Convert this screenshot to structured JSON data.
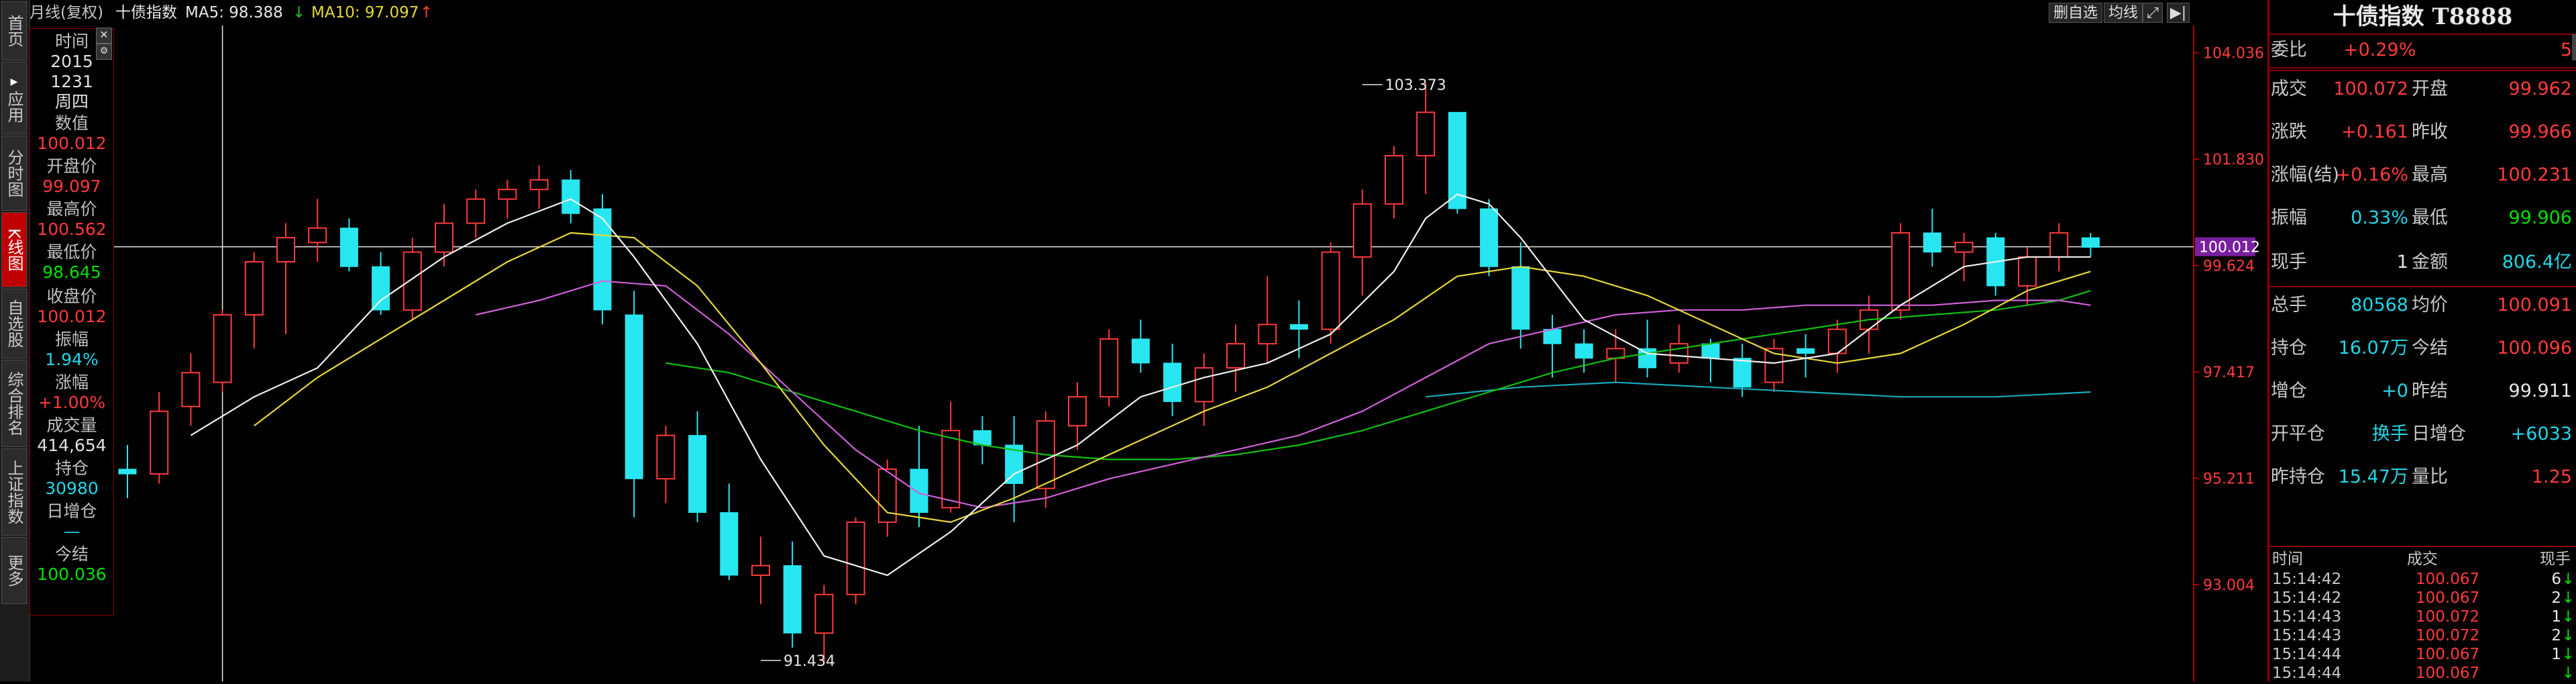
{
  "left_nav": [
    {
      "label": "首页",
      "active": false
    },
    {
      "label": "应用",
      "active": false
    },
    {
      "label": "分时图",
      "active": false
    },
    {
      "label": "K线图",
      "active": true
    },
    {
      "label": "自选股",
      "active": false
    },
    {
      "label": "综合排名",
      "active": false
    },
    {
      "label": "上证指数",
      "active": false
    },
    {
      "label": "更多",
      "active": false
    }
  ],
  "info_panel": {
    "time_label": "时间",
    "year": "2015",
    "date": "1231",
    "weekday": "周四",
    "value_label": "数值",
    "value": "100.012",
    "open_label": "开盘价",
    "open": "99.097",
    "high_label": "最高价",
    "high": "100.562",
    "low_label": "最低价",
    "low": "98.645",
    "close_label": "收盘价",
    "close": "100.012",
    "amplitude_label": "振幅",
    "amplitude": "1.94%",
    "change_label": "涨幅",
    "change": "+1.00%",
    "volume_label": "成交量",
    "volume": "414,654",
    "oi_label": "持仓",
    "oi": "30980",
    "daily_oi_label": "日增仓",
    "daily_oi": "—",
    "settle_label": "今结",
    "settle": "100.036"
  },
  "top_bar": {
    "period": "月线(复权)",
    "name": "十债指数",
    "ma5_label": "MA5: 98.388",
    "ma5_arrow": "↓",
    "ma10_label": "MA10: 97.097",
    "ma10_arrow": "↑",
    "btn_delete": "删自选",
    "btn_ma": "均线"
  },
  "colors": {
    "up": "#ff3b3b",
    "down": "#28e6f0",
    "ma5": "#f0f0f0",
    "ma10": "#e6d83a",
    "ma20": "#d060d8",
    "ma60": "#10c010",
    "ma120": "#1aa8b8",
    "accent": "#8a0000"
  },
  "chart_data": {
    "type": "candlestick",
    "period": "monthly",
    "y_ticks": [
      104.036,
      101.83,
      99.624,
      97.417,
      95.211,
      93.004
    ],
    "ylim": [
      91.0,
      104.6
    ],
    "current_price": 100.012,
    "max_annotation": 103.373,
    "min_annotation": 91.434,
    "max_index": 39,
    "min_index": 20,
    "crosshair_index": 3,
    "candles": [
      [
        95.4,
        95.9,
        94.8,
        95.3
      ],
      [
        95.3,
        97.0,
        95.1,
        96.6
      ],
      [
        96.7,
        97.8,
        96.3,
        97.4
      ],
      [
        97.2,
        98.7,
        97.0,
        98.6
      ],
      [
        98.6,
        99.9,
        97.9,
        99.7
      ],
      [
        99.7,
        100.5,
        98.2,
        100.2
      ],
      [
        100.1,
        101.0,
        99.7,
        100.4
      ],
      [
        100.4,
        100.6,
        99.5,
        99.6
      ],
      [
        99.6,
        99.9,
        98.6,
        98.7
      ],
      [
        98.7,
        100.2,
        98.5,
        99.9
      ],
      [
        99.9,
        100.9,
        99.6,
        100.5
      ],
      [
        100.5,
        101.2,
        100.2,
        101.0
      ],
      [
        101.0,
        101.4,
        100.6,
        101.2
      ],
      [
        101.2,
        101.7,
        100.8,
        101.4
      ],
      [
        101.4,
        101.6,
        100.5,
        100.7
      ],
      [
        100.8,
        101.1,
        98.4,
        98.7
      ],
      [
        98.6,
        99.1,
        94.4,
        95.2
      ],
      [
        95.2,
        96.3,
        94.7,
        96.1
      ],
      [
        96.1,
        96.6,
        94.3,
        94.5
      ],
      [
        94.5,
        95.1,
        93.1,
        93.2
      ],
      [
        93.2,
        94.0,
        92.6,
        93.4
      ],
      [
        93.4,
        93.9,
        91.7,
        92.0
      ],
      [
        92.0,
        93.0,
        91.4,
        92.8
      ],
      [
        92.8,
        94.4,
        92.6,
        94.3
      ],
      [
        94.3,
        95.6,
        94.0,
        95.4
      ],
      [
        95.4,
        96.3,
        94.2,
        94.5
      ],
      [
        94.6,
        96.8,
        94.5,
        96.2
      ],
      [
        96.2,
        96.5,
        95.5,
        95.9
      ],
      [
        95.9,
        96.5,
        94.3,
        95.1
      ],
      [
        95.0,
        96.6,
        94.6,
        96.4
      ],
      [
        96.3,
        97.2,
        95.8,
        96.9
      ],
      [
        96.9,
        98.3,
        96.7,
        98.1
      ],
      [
        98.1,
        98.5,
        97.4,
        97.6
      ],
      [
        97.6,
        98.0,
        96.5,
        96.8
      ],
      [
        96.8,
        97.8,
        96.3,
        97.5
      ],
      [
        97.5,
        98.4,
        97.0,
        98.0
      ],
      [
        98.0,
        99.4,
        97.6,
        98.4
      ],
      [
        98.4,
        98.9,
        97.7,
        98.3
      ],
      [
        98.3,
        100.1,
        98.0,
        99.9
      ],
      [
        99.8,
        101.2,
        99.0,
        100.9
      ],
      [
        100.9,
        102.1,
        100.6,
        101.9
      ],
      [
        101.9,
        103.4,
        101.1,
        102.8
      ],
      [
        102.8,
        102.8,
        100.7,
        100.8
      ],
      [
        100.8,
        101.0,
        99.4,
        99.6
      ],
      [
        99.6,
        100.1,
        97.9,
        98.3
      ],
      [
        98.3,
        98.6,
        97.3,
        98.0
      ],
      [
        98.0,
        98.3,
        97.4,
        97.7
      ],
      [
        97.7,
        98.3,
        97.2,
        97.9
      ],
      [
        97.9,
        98.5,
        97.3,
        97.5
      ],
      [
        97.6,
        98.4,
        97.4,
        98.0
      ],
      [
        98.0,
        98.1,
        97.2,
        97.7
      ],
      [
        97.7,
        98.0,
        96.9,
        97.1
      ],
      [
        97.2,
        98.1,
        97.0,
        97.9
      ],
      [
        97.9,
        98.2,
        97.3,
        97.8
      ],
      [
        97.8,
        98.5,
        97.4,
        98.3
      ],
      [
        98.3,
        99.0,
        97.8,
        98.7
      ],
      [
        98.7,
        100.5,
        98.5,
        100.3
      ],
      [
        100.3,
        100.8,
        99.6,
        99.9
      ],
      [
        99.9,
        100.3,
        99.3,
        100.1
      ],
      [
        100.2,
        100.3,
        99.0,
        99.2
      ],
      [
        99.2,
        100.0,
        98.8,
        99.8
      ],
      [
        99.8,
        100.5,
        99.5,
        100.3
      ],
      [
        100.2,
        100.3,
        99.8,
        100.0
      ]
    ],
    "ma5": [
      [
        2,
        96.1
      ],
      [
        4,
        96.9
      ],
      [
        6,
        97.5
      ],
      [
        8,
        98.9
      ],
      [
        10,
        99.8
      ],
      [
        12,
        100.5
      ],
      [
        14,
        101.0
      ],
      [
        15,
        100.6
      ],
      [
        16,
        99.8
      ],
      [
        18,
        98.0
      ],
      [
        20,
        95.6
      ],
      [
        22,
        93.6
      ],
      [
        24,
        93.2
      ],
      [
        26,
        94.1
      ],
      [
        28,
        95.3
      ],
      [
        30,
        95.9
      ],
      [
        32,
        96.9
      ],
      [
        34,
        97.3
      ],
      [
        36,
        97.6
      ],
      [
        38,
        98.2
      ],
      [
        40,
        99.5
      ],
      [
        41,
        100.6
      ],
      [
        42,
        101.1
      ],
      [
        43,
        100.9
      ],
      [
        44,
        100.2
      ],
      [
        46,
        98.5
      ],
      [
        48,
        97.8
      ],
      [
        50,
        97.7
      ],
      [
        52,
        97.6
      ],
      [
        54,
        97.8
      ],
      [
        56,
        98.8
      ],
      [
        58,
        99.6
      ],
      [
        60,
        99.8
      ],
      [
        62,
        99.8
      ]
    ],
    "ma10": [
      [
        4,
        96.3
      ],
      [
        6,
        97.3
      ],
      [
        8,
        98.1
      ],
      [
        10,
        98.9
      ],
      [
        12,
        99.7
      ],
      [
        14,
        100.3
      ],
      [
        16,
        100.2
      ],
      [
        18,
        99.2
      ],
      [
        20,
        97.6
      ],
      [
        22,
        95.9
      ],
      [
        24,
        94.5
      ],
      [
        26,
        94.3
      ],
      [
        28,
        94.8
      ],
      [
        30,
        95.4
      ],
      [
        32,
        96.0
      ],
      [
        34,
        96.6
      ],
      [
        36,
        97.1
      ],
      [
        38,
        97.8
      ],
      [
        40,
        98.5
      ],
      [
        42,
        99.4
      ],
      [
        44,
        99.6
      ],
      [
        46,
        99.4
      ],
      [
        48,
        99.0
      ],
      [
        50,
        98.4
      ],
      [
        52,
        97.8
      ],
      [
        54,
        97.6
      ],
      [
        56,
        97.8
      ],
      [
        58,
        98.4
      ],
      [
        60,
        99.1
      ],
      [
        62,
        99.5
      ]
    ],
    "ma20": [
      [
        11,
        98.6
      ],
      [
        13,
        98.9
      ],
      [
        15,
        99.3
      ],
      [
        17,
        99.2
      ],
      [
        19,
        98.2
      ],
      [
        21,
        97.0
      ],
      [
        23,
        95.8
      ],
      [
        25,
        94.9
      ],
      [
        27,
        94.6
      ],
      [
        29,
        94.8
      ],
      [
        31,
        95.2
      ],
      [
        33,
        95.5
      ],
      [
        35,
        95.8
      ],
      [
        37,
        96.1
      ],
      [
        39,
        96.6
      ],
      [
        41,
        97.3
      ],
      [
        43,
        98.0
      ],
      [
        45,
        98.3
      ],
      [
        47,
        98.6
      ],
      [
        49,
        98.7
      ],
      [
        51,
        98.7
      ],
      [
        53,
        98.8
      ],
      [
        55,
        98.8
      ],
      [
        57,
        98.8
      ],
      [
        59,
        98.9
      ],
      [
        61,
        98.9
      ],
      [
        62,
        98.8
      ]
    ],
    "ma60": [
      [
        17,
        97.6
      ],
      [
        19,
        97.4
      ],
      [
        21,
        97.0
      ],
      [
        23,
        96.6
      ],
      [
        25,
        96.2
      ],
      [
        27,
        95.9
      ],
      [
        29,
        95.7
      ],
      [
        31,
        95.6
      ],
      [
        33,
        95.6
      ],
      [
        35,
        95.7
      ],
      [
        37,
        95.9
      ],
      [
        39,
        96.2
      ],
      [
        41,
        96.6
      ],
      [
        43,
        97.0
      ],
      [
        45,
        97.4
      ],
      [
        47,
        97.7
      ],
      [
        49,
        97.9
      ],
      [
        51,
        98.1
      ],
      [
        53,
        98.3
      ],
      [
        55,
        98.5
      ],
      [
        57,
        98.6
      ],
      [
        59,
        98.7
      ],
      [
        61,
        98.9
      ],
      [
        62,
        99.1
      ]
    ],
    "ma120": [
      [
        41,
        96.9
      ],
      [
        44,
        97.1
      ],
      [
        47,
        97.2
      ],
      [
        50,
        97.1
      ],
      [
        53,
        97.0
      ],
      [
        56,
        96.9
      ],
      [
        59,
        96.9
      ],
      [
        62,
        97.0
      ]
    ]
  },
  "right_panel": {
    "title": "十债指数 T8888",
    "wei_bi_label": "委比",
    "wei_bi_value": "+0.29%",
    "wei_bi_right": "5",
    "rows": [
      {
        "l1": "成交",
        "v1": "100.072",
        "c1": "red",
        "l2": "开盘",
        "v2": "99.962",
        "c2": "red"
      },
      {
        "l1": "涨跌",
        "v1": "+0.161",
        "c1": "red",
        "l2": "昨收",
        "v2": "99.966",
        "c2": "red"
      },
      {
        "l1": "涨幅(结)",
        "v1": "+0.16%",
        "c1": "red",
        "l2": "最高",
        "v2": "100.231",
        "c2": "red"
      },
      {
        "l1": "振幅",
        "v1": "0.33%",
        "c1": "cyan",
        "l2": "最低",
        "v2": "99.906",
        "c2": "green"
      },
      {
        "l1": "现手",
        "v1": "1",
        "c1": "white",
        "l2": "金额",
        "v2": "806.4亿",
        "c2": "cyan"
      },
      {
        "l1": "总手",
        "v1": "80568",
        "c1": "cyan",
        "l2": "均价",
        "v2": "100.091",
        "c2": "red"
      },
      {
        "l1": "持仓",
        "v1": "16.07万",
        "c1": "cyan",
        "l2": "今结",
        "v2": "100.096",
        "c2": "red"
      },
      {
        "l1": "增仓",
        "v1": "+0",
        "c1": "cyan",
        "l2": "昨结",
        "v2": "99.911",
        "c2": "white"
      },
      {
        "l1": "开平仓",
        "v1": "换手",
        "c1": "cyan",
        "l2": "日增仓",
        "v2": "+6033",
        "c2": "cyan"
      },
      {
        "l1": "昨持仓",
        "v1": "15.47万",
        "c1": "cyan",
        "l2": "量比",
        "v2": "1.25",
        "c2": "red"
      }
    ],
    "ticks_header": {
      "time": "时间",
      "price": "成交",
      "vol": "现手"
    },
    "ticks": [
      {
        "time": "15:14:42",
        "price": "100.067",
        "vol": "6",
        "dir": "down"
      },
      {
        "time": "15:14:42",
        "price": "100.067",
        "vol": "2",
        "dir": "down"
      },
      {
        "time": "15:14:43",
        "price": "100.072",
        "vol": "1",
        "dir": "down"
      },
      {
        "time": "15:14:43",
        "price": "100.072",
        "vol": "2",
        "dir": "down"
      },
      {
        "time": "15:14:44",
        "price": "100.067",
        "vol": "1",
        "dir": "down"
      },
      {
        "time": "15:14:44",
        "price": "100.067",
        "vol": "",
        "dir": "down"
      }
    ]
  }
}
